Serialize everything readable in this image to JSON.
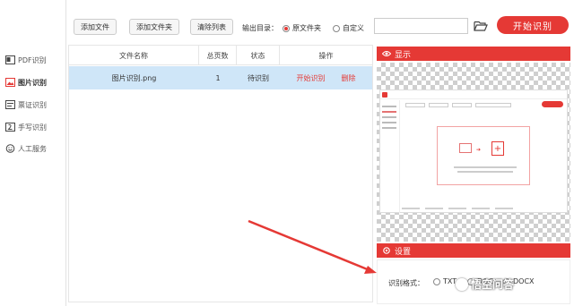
{
  "sidebar": {
    "items": [
      {
        "label": "PDF识别",
        "icon": "pdf-icon",
        "active": false
      },
      {
        "label": "图片识别",
        "icon": "image-icon",
        "active": true
      },
      {
        "label": "票证识别",
        "icon": "ticket-icon",
        "active": false
      },
      {
        "label": "手写识别",
        "icon": "handwriting-icon",
        "active": false
      },
      {
        "label": "人工服务",
        "icon": "smiley-icon",
        "active": false
      }
    ]
  },
  "toolbar": {
    "add_file": "添加文件",
    "add_folder": "添加文件夹",
    "clear_list": "清除列表",
    "output_label": "输出目录：",
    "option_source": "原文件夹",
    "option_custom": "自定义",
    "path_value": "",
    "start": "开始识别"
  },
  "table": {
    "headers": [
      "文件名称",
      "总页数",
      "状态",
      "操作"
    ],
    "rows": [
      {
        "name": "图片识别.png",
        "pages": "1",
        "status": "待识别",
        "op_start": "开始识别",
        "op_delete": "删除"
      }
    ]
  },
  "preview": {
    "title": "显示"
  },
  "settings": {
    "title": "设置",
    "format_label": "识别格式：",
    "formats": [
      "TXT",
      "DOC",
      "DOCX"
    ]
  },
  "watermark": "悟空问答",
  "colors": {
    "accent": "#e53935",
    "selected_row": "#cfe6f8"
  }
}
